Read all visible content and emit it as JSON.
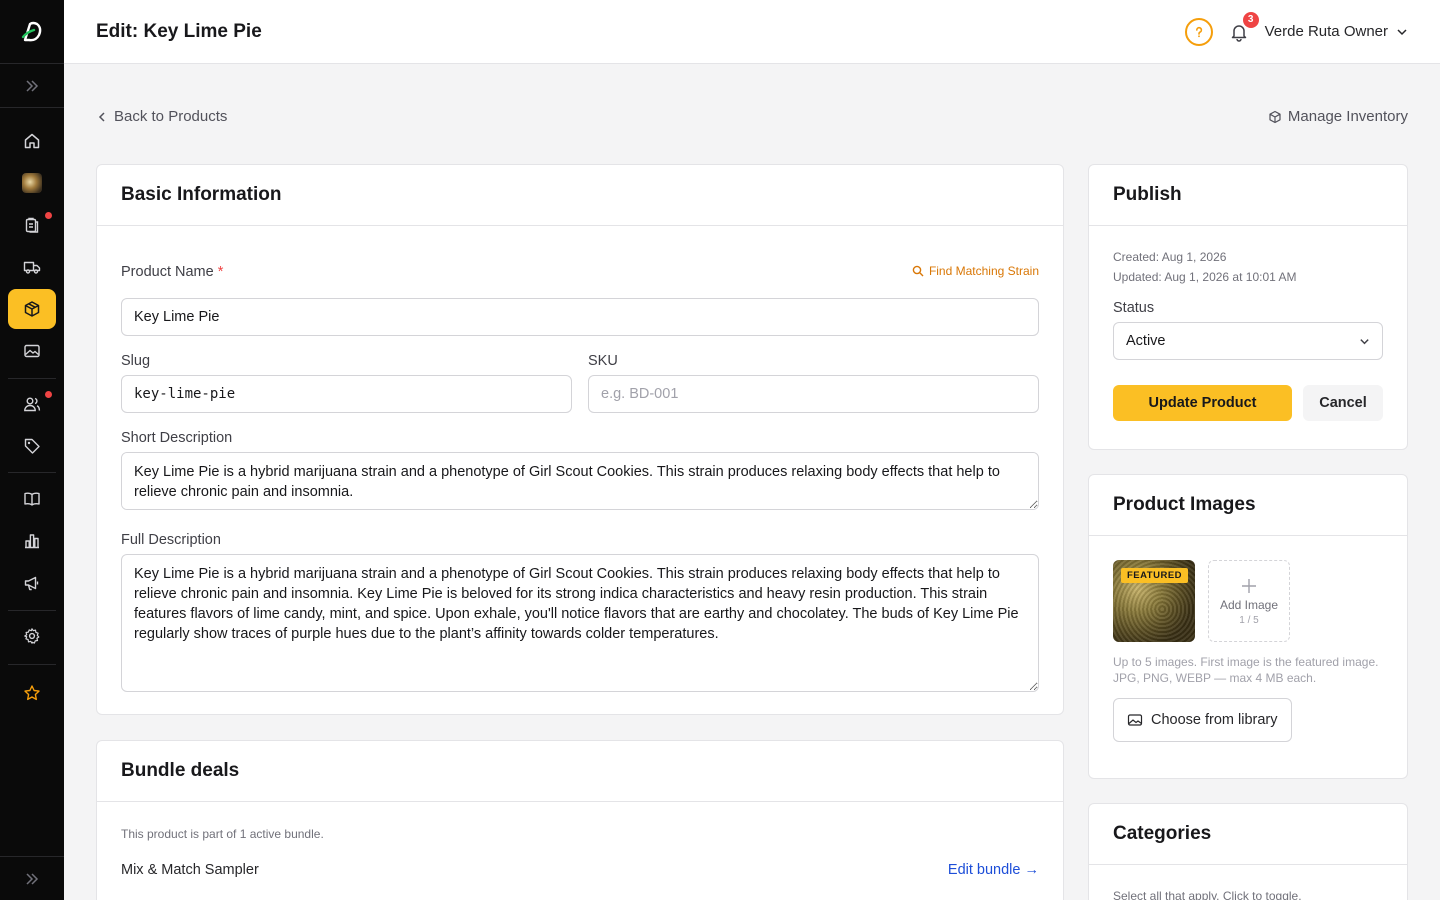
{
  "header": {
    "title": "Edit: Key Lime Pie",
    "notifications_count": "3",
    "user_name": "Verde Ruta Owner"
  },
  "nav": {
    "back_label": "Back to Products",
    "manage_label": "Manage Inventory"
  },
  "sidebar": {
    "items": [
      {
        "icon": "home-icon",
        "active": false
      },
      {
        "icon": "store-avatar",
        "active": false
      },
      {
        "icon": "clipboard-icon",
        "active": false,
        "dot": true
      },
      {
        "icon": "truck-icon",
        "active": false
      },
      {
        "icon": "package-icon",
        "active": true
      },
      {
        "icon": "image-icon",
        "active": false
      },
      {
        "icon": "users-icon",
        "active": false,
        "dot": true
      },
      {
        "icon": "tag-icon",
        "active": false
      },
      {
        "icon": "book-icon",
        "active": false
      },
      {
        "icon": "chart-icon",
        "active": false
      },
      {
        "icon": "megaphone-icon",
        "active": false
      },
      {
        "icon": "gear-icon",
        "active": false
      },
      {
        "icon": "star-icon",
        "active": false
      }
    ]
  },
  "basic_info": {
    "heading": "Basic Information",
    "product_name_label": "Product Name",
    "required_mark": "*",
    "find_strain_label": "Find Matching Strain",
    "product_name_value": "Key Lime Pie",
    "slug_label": "Slug",
    "slug_value": "key-lime-pie",
    "sku_label": "SKU",
    "sku_placeholder": "e.g. BD-001",
    "short_desc_label": "Short Description",
    "short_desc_value": "Key Lime Pie is a hybrid marijuana strain and a phenotype of Girl Scout Cookies. This strain produces relaxing body effects that help to relieve chronic pain and insomnia.",
    "full_desc_label": "Full Description",
    "full_desc_value": "Key Lime Pie is a hybrid marijuana strain and a phenotype of Girl Scout Cookies. This strain produces relaxing body effects that help to relieve chronic pain and insomnia. Key Lime Pie is beloved for its strong indica characteristics and heavy resin production. This strain features flavors of lime candy, mint, and spice. Upon exhale, you'll notice flavors that are earthy and chocolatey. The buds of Key Lime Pie regularly show traces of purple hues due to the plant’s affinity towards colder temperatures."
  },
  "bundle": {
    "heading": "Bundle deals",
    "info": "This product is part of 1 active bundle.",
    "name": "Mix & Match Sampler",
    "edit_label": "Edit bundle →"
  },
  "publish": {
    "heading": "Publish",
    "created": "Created: Aug 1, 2026",
    "updated": "Updated: Aug 1, 2026 at 10:01 AM",
    "status_label": "Status",
    "status_value": "Active",
    "update_label": "Update Product",
    "cancel_label": "Cancel"
  },
  "images": {
    "heading": "Product Images",
    "featured_badge": "FEATURED",
    "add_label": "Add Image",
    "count": "1 / 5",
    "hint": "Up to 5 images. First image is the featured image. JPG, PNG, WEBP — max 4 MB each.",
    "library_label": "Choose from library"
  },
  "categories": {
    "heading": "Categories",
    "hint": "Select all that apply. Click to toggle."
  },
  "colors": {
    "accent": "#fbbf24",
    "sidebar_bg": "#0a0a0a",
    "link": "#1d4ed8",
    "badge": "#ef4444"
  }
}
